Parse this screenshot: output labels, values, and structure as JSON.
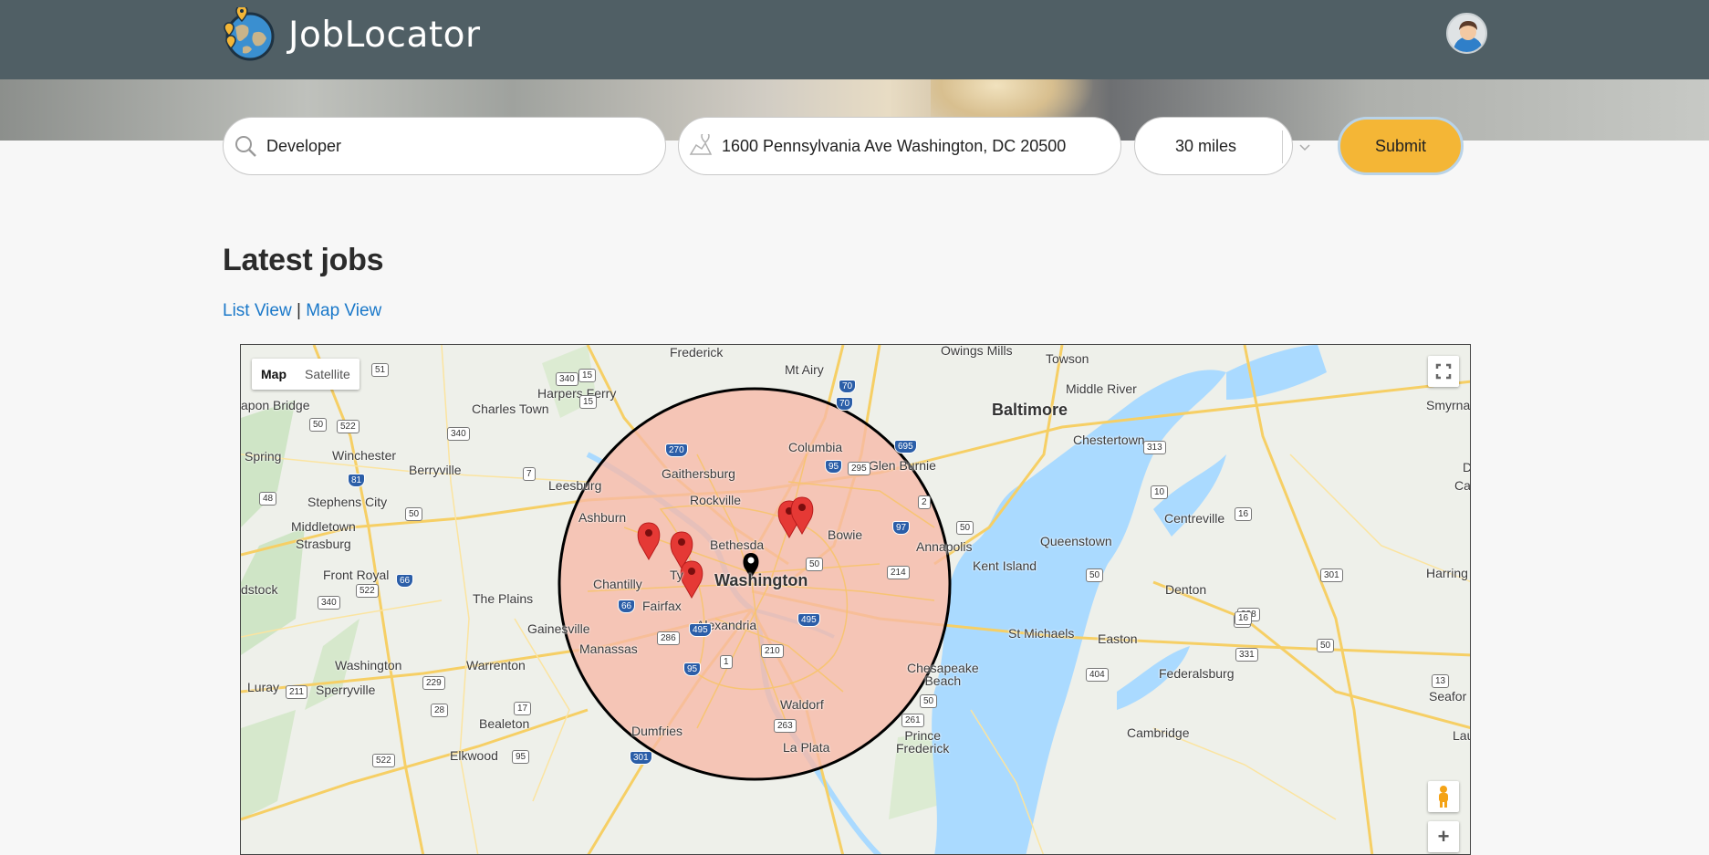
{
  "header": {
    "app_name": "JobLocator",
    "logo_icon": "globe-pins-icon",
    "avatar_icon": "user-avatar-icon"
  },
  "search": {
    "keyword_value": "Developer",
    "keyword_icon": "search-icon",
    "location_value": "1600 Pennsylvania Ave Washington, DC 20500",
    "location_icon": "map-icon",
    "radius_value": "30 miles",
    "radius_caret": "chevron-down-icon",
    "submit_label": "Submit"
  },
  "main": {
    "title": "Latest jobs",
    "list_view_label": "List View",
    "separator": "|",
    "map_view_label": "Map View"
  },
  "map": {
    "type_map_label": "Map",
    "type_satellite_label": "Satellite",
    "zoom_in_label": "+",
    "circle_fill": "#f7b8a6",
    "pin_color": "#e53935",
    "center_pin_color": "#000000",
    "labels": {
      "frederick": "Frederick",
      "mtairy": "Mt Airy",
      "owingsmills": "Owings Mills",
      "towson": "Towson",
      "baltimore": "Baltimore",
      "middleriver": "Middle River",
      "smyrna": "Smyrna",
      "harpersferry": "Harpers Ferry",
      "charlestown": "Charles Town",
      "caponbridge": "apon Bridge",
      "winchester": "Winchester",
      "berryville": "Berryville",
      "spring": "Spring",
      "stephenscity": "Stephens City",
      "middletown": "Middletown",
      "strasburg": "Strasburg",
      "frontroyal": "Front Royal",
      "dstock": "dstock",
      "leesburg": "Leesburg",
      "ashburn": "Ashburn",
      "chantilly": "Chantilly",
      "fairfax": "Fairfax",
      "theplains": "The Plains",
      "gainesville": "Gainesville",
      "manassas": "Manassas",
      "washingtonva": "Washington",
      "warrenton": "Warrenton",
      "luray": "Luray",
      "sperryville": "Sperryville",
      "bealeton": "Bealeton",
      "elkwood": "Elkwood",
      "gaithersburg": "Gaithersburg",
      "rockville": "Rockville",
      "bethesda": "Bethesda",
      "columbia": "Columbia",
      "glenburnie": "Glen Burnie",
      "bowie": "Bowie",
      "annapolis": "Annapolis",
      "washington": "Washington",
      "alexandria": "Alexandria",
      "tysons": "Ty",
      "waldorf": "Waldorf",
      "dumfries": "Dumfries",
      "laplata": "La Plata",
      "princefrederick": "Prince\nFrederick",
      "chesapeakebeach": "Chesapeake\nBeach",
      "chestertown": "Chestertown",
      "centreville": "Centreville",
      "queenstown": "Queenstown",
      "kentisland": "Kent Island",
      "denton": "Denton",
      "harring": "Harring",
      "stmichaels": "St Michaels",
      "easton": "Easton",
      "federalsburg": "Federalsburg",
      "cambridge": "Cambridge",
      "seaford": "Seafor",
      "ca": "Ca",
      "d": "D",
      "laur": "Lau"
    },
    "shields": [
      "51",
      "340",
      "15",
      "70",
      "70",
      "695",
      "270",
      "95",
      "295",
      "7",
      "81",
      "50",
      "522",
      "340",
      "48",
      "50",
      "66",
      "522",
      "340",
      "2",
      "97",
      "50",
      "50",
      "214",
      "495",
      "66",
      "286",
      "495",
      "210",
      "1",
      "95",
      "211",
      "229",
      "28",
      "17",
      "95",
      "301",
      "263",
      "261",
      "50",
      "50",
      "404",
      "301",
      "313",
      "10",
      "16",
      "328",
      "331",
      "50",
      "13",
      "16",
      "16",
      "15",
      "522"
    ]
  }
}
